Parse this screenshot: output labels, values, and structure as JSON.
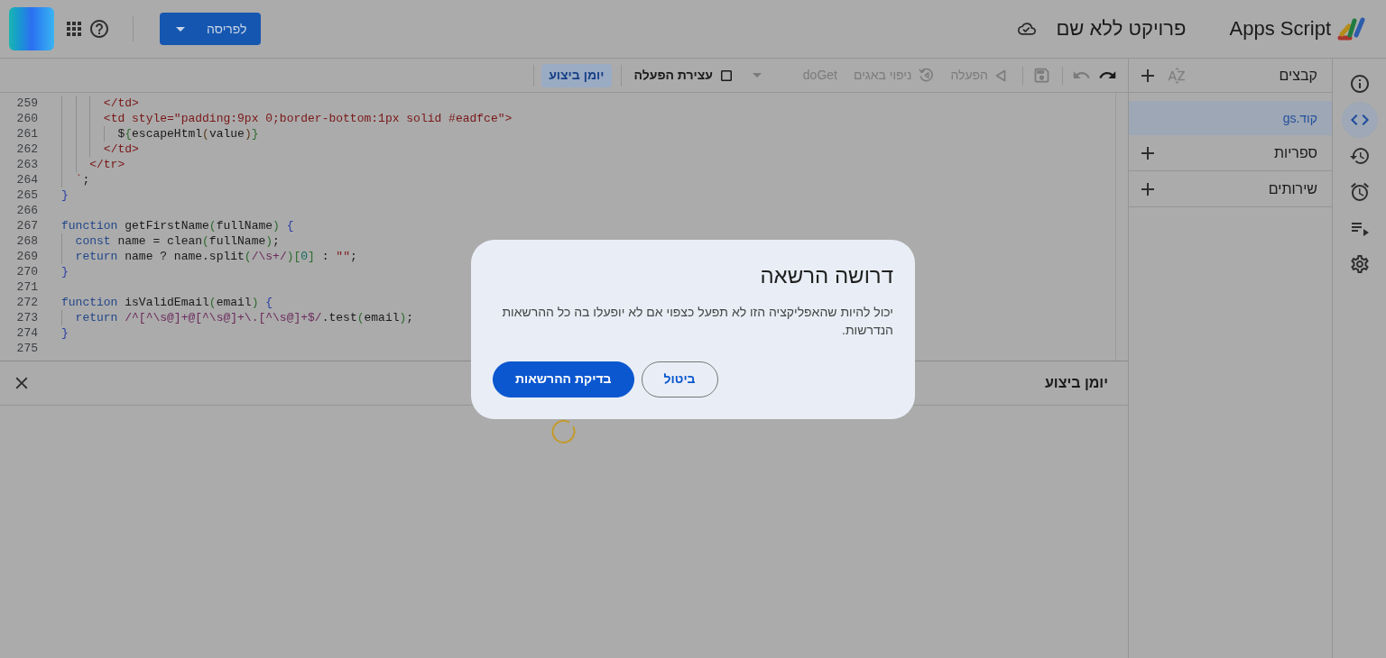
{
  "header": {
    "app_name": "Apps Script",
    "project_title": "פרויקט ללא שם",
    "deploy_button": "לפריסה"
  },
  "rail": [
    {
      "kind": "info",
      "selected": false
    },
    {
      "kind": "editor",
      "selected": true
    },
    {
      "kind": "history",
      "selected": false
    },
    {
      "kind": "triggers",
      "selected": false
    },
    {
      "kind": "executions",
      "selected": false
    },
    {
      "kind": "settings",
      "selected": false
    }
  ],
  "files_panel": {
    "title": "קבצים",
    "files": [
      {
        "name": "קוד.gs",
        "selected": true
      }
    ],
    "sections": [
      {
        "title": "ספריות"
      },
      {
        "title": "שירותים"
      }
    ]
  },
  "toolbar": {
    "undo": {
      "disabled": false
    },
    "redo": {
      "disabled": true
    },
    "save": {
      "disabled": true
    },
    "run": {
      "label": "הפעלה",
      "disabled": true
    },
    "debug": {
      "label": "ניפוי באגים",
      "disabled": true
    },
    "function_select": {
      "value": "doGet",
      "disabled": true
    },
    "stop": {
      "label": "עצירת הפעלה",
      "disabled": false
    },
    "log_toggle": {
      "label": "יומן ביצוע",
      "selected": true
    }
  },
  "editor": {
    "lines": [
      {
        "number": "259",
        "tokens": [
          {
            "kind": "tag",
            "text": "      </td>"
          }
        ]
      },
      {
        "number": "260",
        "tokens": [
          {
            "kind": "tag",
            "text": "      <td style=\"padding:9px 0;border-bottom:1px solid #eadfce\">"
          }
        ]
      },
      {
        "number": "261",
        "tokens": [
          {
            "kind": "plain",
            "text": "        $"
          },
          {
            "kind": "bracket2",
            "text": "{"
          },
          {
            "kind": "plain",
            "text": "escapeHtml"
          },
          {
            "kind": "bracket3",
            "text": "("
          },
          {
            "kind": "plain",
            "text": "value"
          },
          {
            "kind": "bracket3",
            "text": ")"
          },
          {
            "kind": "bracket2",
            "text": "}"
          }
        ]
      },
      {
        "number": "262",
        "tokens": [
          {
            "kind": "tag",
            "text": "      </td>"
          }
        ]
      },
      {
        "number": "263",
        "tokens": [
          {
            "kind": "tag",
            "text": "    </tr>"
          }
        ]
      },
      {
        "number": "264",
        "tokens": [
          {
            "kind": "string",
            "text": "  `"
          },
          {
            "kind": "plain",
            "text": ";"
          }
        ]
      },
      {
        "number": "265",
        "tokens": [
          {
            "kind": "bracket1",
            "text": "}"
          }
        ]
      },
      {
        "number": "266"
      },
      {
        "number": "267",
        "tokens": [
          {
            "kind": "keyword",
            "text": "function"
          },
          {
            "kind": "plain",
            "text": " getFirstName"
          },
          {
            "kind": "bracket2",
            "text": "("
          },
          {
            "kind": "plain",
            "text": "fullName"
          },
          {
            "kind": "bracket2",
            "text": ")"
          },
          {
            "kind": "bracket1",
            "text": " {"
          }
        ]
      },
      {
        "number": "268",
        "tokens": [
          {
            "kind": "keyword",
            "text": "  const"
          },
          {
            "kind": "plain",
            "text": " name = clean"
          },
          {
            "kind": "bracket2",
            "text": "("
          },
          {
            "kind": "plain",
            "text": "fullName"
          },
          {
            "kind": "bracket2",
            "text": ")"
          },
          {
            "kind": "plain",
            "text": ";"
          }
        ]
      },
      {
        "number": "269",
        "tokens": [
          {
            "kind": "keyword",
            "text": "  return"
          },
          {
            "kind": "plain",
            "text": " name ? name.split"
          },
          {
            "kind": "bracket2",
            "text": "("
          },
          {
            "kind": "regex",
            "text": "/\\s+/"
          },
          {
            "kind": "bracket2",
            "text": ")["
          },
          {
            "kind": "number",
            "text": "0"
          },
          {
            "kind": "bracket2",
            "text": "]"
          },
          {
            "kind": "plain",
            "text": " : "
          },
          {
            "kind": "string",
            "text": "\"\""
          },
          {
            "kind": "plain",
            "text": ";"
          }
        ]
      },
      {
        "number": "270",
        "tokens": [
          {
            "kind": "bracket1",
            "text": "}"
          }
        ]
      },
      {
        "number": "271"
      },
      {
        "number": "272",
        "tokens": [
          {
            "kind": "keyword",
            "text": "function"
          },
          {
            "kind": "plain",
            "text": " isValidEmail"
          },
          {
            "kind": "bracket2",
            "text": "("
          },
          {
            "kind": "plain",
            "text": "email"
          },
          {
            "kind": "bracket2",
            "text": ")"
          },
          {
            "kind": "bracket1",
            "text": " {"
          }
        ]
      },
      {
        "number": "273",
        "tokens": [
          {
            "kind": "keyword",
            "text": "  return"
          },
          {
            "kind": "regex",
            "text": " /^[^\\s@]+@[^\\s@]+\\.[^\\s@]+$/"
          },
          {
            "kind": "plain",
            "text": ".test"
          },
          {
            "kind": "bracket2",
            "text": "("
          },
          {
            "kind": "plain",
            "text": "email"
          },
          {
            "kind": "bracket2",
            "text": ")"
          },
          {
            "kind": "plain",
            "text": ";"
          }
        ]
      },
      {
        "number": "274",
        "tokens": [
          {
            "kind": "bracket1",
            "text": "}"
          }
        ]
      },
      {
        "number": "275"
      }
    ]
  },
  "log_panel": {
    "title": "יומן ביצוע",
    "loading": true
  },
  "dialog": {
    "title": "דרושה הרשאה",
    "message": "יכול להיות שהאפליקציה הזו לא תפעל כצפוי אם לא יופעלו בה כל ההרשאות הנדרשות.",
    "buttons": [
      {
        "label": "ביטול",
        "kind": "outlined"
      },
      {
        "label": "בדיקת ההרשאות",
        "kind": "filled"
      }
    ]
  }
}
